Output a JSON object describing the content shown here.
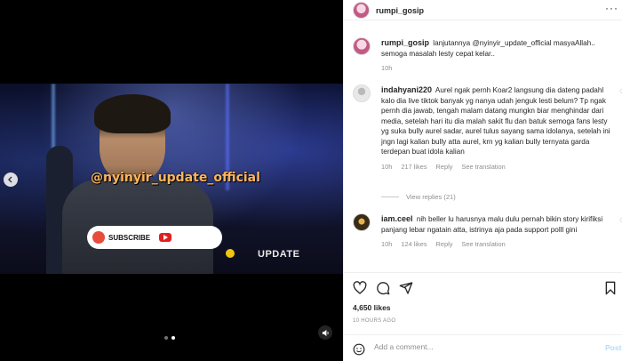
{
  "media": {
    "watermark": "@nyinyir_update_official",
    "subscribe_label": "SUBSCRIBE",
    "update_label": "UPDATE",
    "carousel_total": 2,
    "carousel_active": 2
  },
  "post": {
    "author": "rumpi_gosip",
    "caption_author": "rumpi_gosip",
    "caption": "lanjutannya @nyinyir_update_official masyaAllah.. semoga masalah lesty cepat kelar..",
    "caption_time": "10h"
  },
  "comments": [
    {
      "username": "indahyani220",
      "text": "Aurel ngak pernh Koar2 langsung dia dateng padahl kalo dia live tiktok banyak yg nanya udah jenguk lesti belum? Tp ngak pernh dia jawab, tengah malam datang mungkn biar menghindar dari media, setelah hari itu dia malah sakit flu dan batuk semoga fans lesty yg suka bully aurel sadar, aurel tulus sayang sama idolanya, setelah ini jngn lagi kalian bully atta aurel, krn yg kalian bully ternyata garda terdepan buat idola kalian",
      "time": "10h",
      "likes": "217 likes",
      "reply": "Reply",
      "translate": "See translation",
      "view_replies": "View replies (21)"
    },
    {
      "username": "iam.ceel",
      "text": "nih beller lu harusnya malu dulu pernah bikin story kirifiksi panjang lebar ngatain atta, istrinya aja pada support polll gini",
      "time": "10h",
      "likes": "124 likes",
      "reply": "Reply",
      "translate": "See translation"
    }
  ],
  "stats": {
    "likes": "4,650 likes",
    "time_ago": "10 HOURS AGO"
  },
  "add_comment": {
    "placeholder": "Add a comment...",
    "post_label": "Post"
  },
  "icons": {
    "heart": "heart-icon",
    "comment": "comment-icon",
    "share": "share-icon",
    "save": "bookmark-icon",
    "emoji": "emoji-icon",
    "more": "more-icon"
  },
  "colors": {
    "post_button": "#b3dbff",
    "muted_text": "#8e8e8e",
    "watermark": "#ffb65c"
  }
}
